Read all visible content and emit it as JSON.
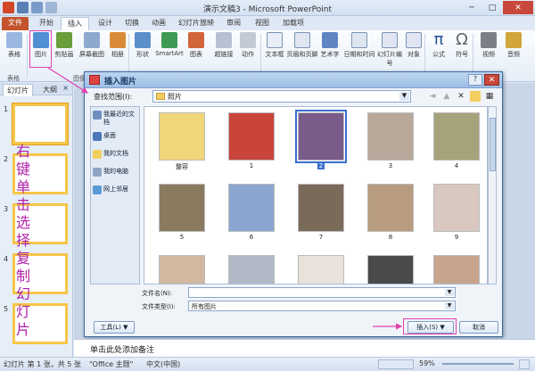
{
  "window": {
    "title": "演示文稿3 - Microsoft PowerPoint",
    "controls": [
      "─",
      "□",
      "✕"
    ]
  },
  "tabs": [
    "文件",
    "开始",
    "插入",
    "设计",
    "切换",
    "动画",
    "幻灯片放映",
    "审阅",
    "视图",
    "加载项"
  ],
  "ribbon": {
    "buttons": [
      "表格",
      "图片",
      "剪贴画",
      "屏幕截图",
      "相册",
      "形状",
      "SmartArt",
      "图表",
      "超链接",
      "动作",
      "文本框",
      "页眉和页脚",
      "艺术字",
      "日期和时间",
      "幻灯片编号",
      "对象",
      "公式",
      "符号",
      "视频",
      "音频"
    ],
    "group_tables": "表格",
    "group_images": "图像"
  },
  "left_panel": {
    "tab_slides": "幻灯片",
    "tab_outline": "大纲",
    "close": "×",
    "slide_numbers": [
      "1",
      "2",
      "3",
      "4",
      "5"
    ]
  },
  "annotation": {
    "text": "右键单击选择复制幻灯片"
  },
  "dialog": {
    "title": "插入图片",
    "help": "?",
    "close": "✕",
    "look_in_label": "查找范围(I):",
    "look_in_value": "照片",
    "places": [
      "我最近的文档",
      "桌面",
      "我的文档",
      "我的电脑",
      "网上邻居"
    ],
    "files": [
      "整容",
      "1",
      "2",
      "3",
      "4",
      "5",
      "6",
      "7",
      "8",
      "9",
      "",
      "",
      "",
      "",
      ""
    ],
    "selected_file": "2",
    "file_name_label": "文件名(N):",
    "file_name_value": "",
    "file_type_label": "文件类型(I):",
    "file_type_value": "所有图片",
    "tools_button": "工具(L)",
    "insert_button": "插入(S)",
    "cancel_button": "取消"
  },
  "notes": {
    "placeholder": "单击此处添加备注"
  },
  "status": {
    "slide_info": "幻灯片 第 1 张，共 5 张",
    "theme": "\"Office 主题\"",
    "language": "中文(中国)",
    "zoom": "59%"
  },
  "colors": {
    "file_tab": "#c5532d",
    "annotation": "#b020a8",
    "highlight": "#e040b0",
    "thumb_border": "#f6c64a",
    "selection": "#3a6ed0"
  }
}
